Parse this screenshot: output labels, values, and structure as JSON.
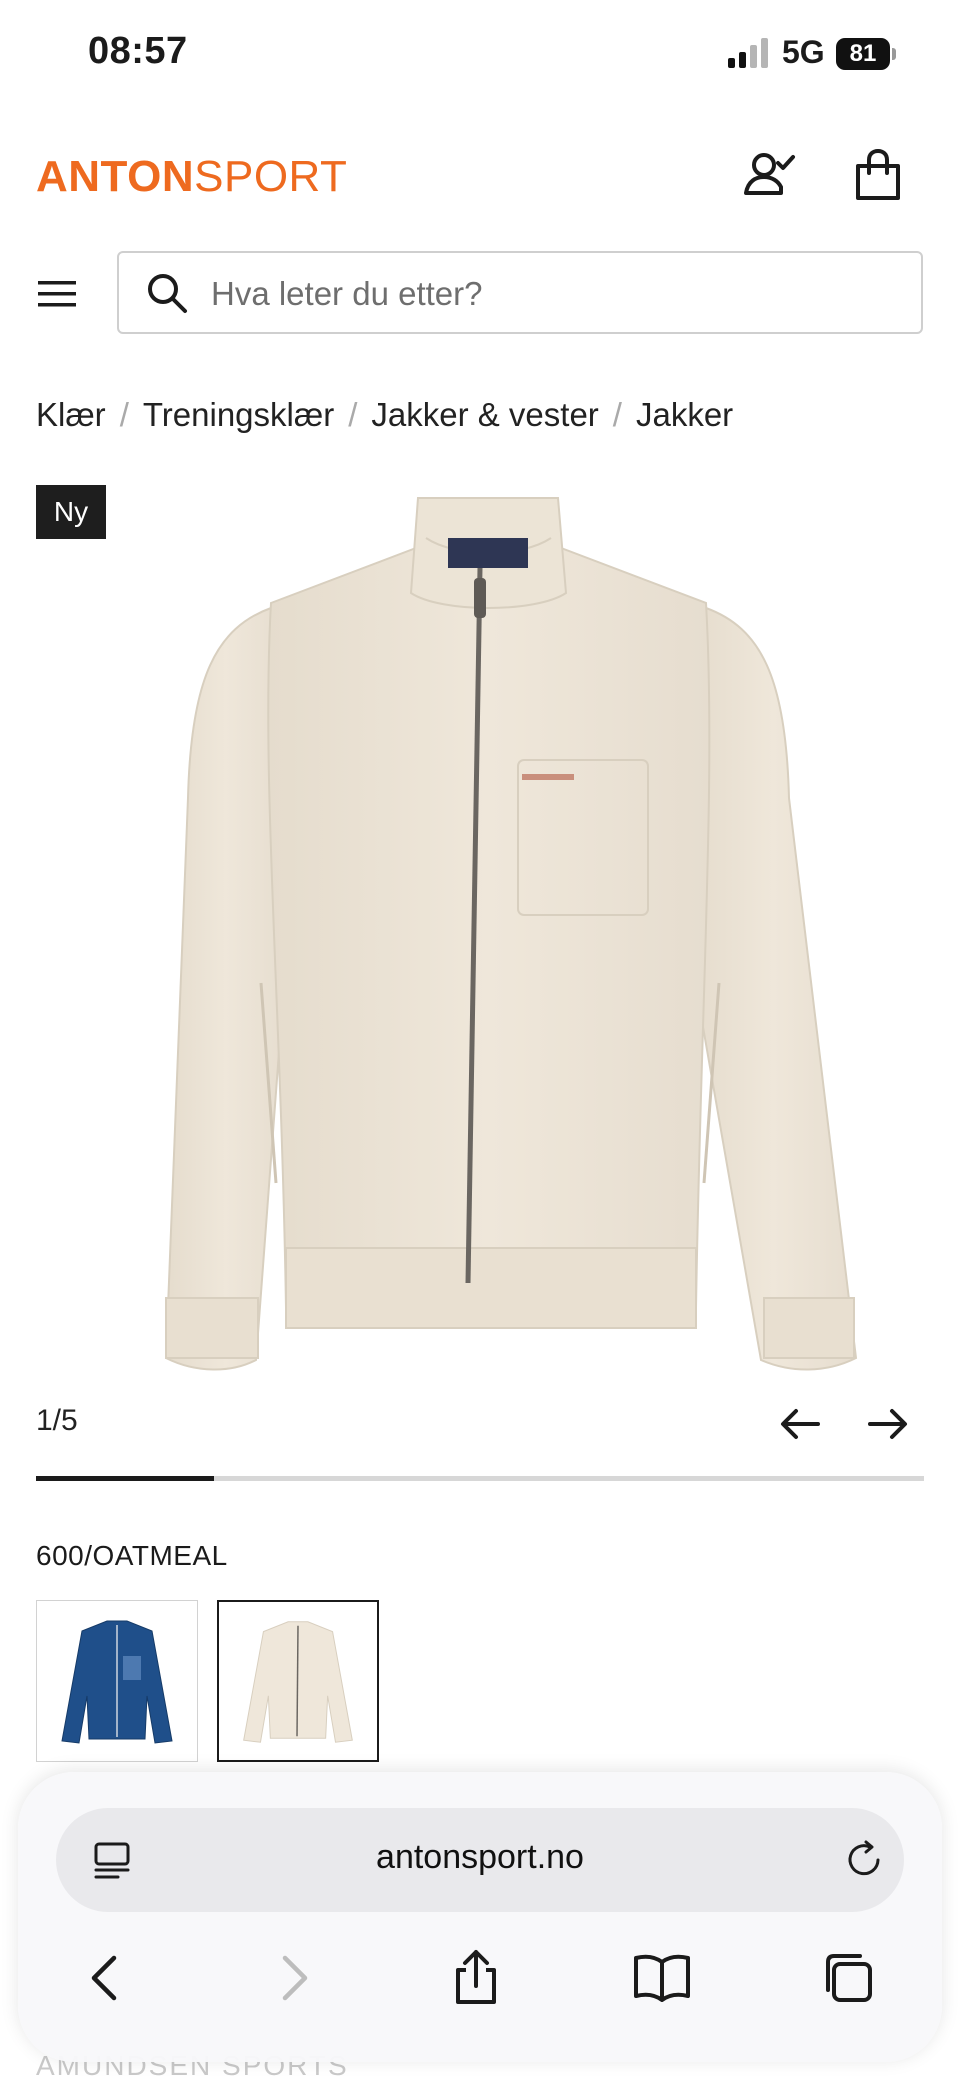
{
  "status_bar": {
    "time": "08:57",
    "network": "5G",
    "battery": "81"
  },
  "header": {
    "brand_bold": "ANTON",
    "brand_light": "SPORT"
  },
  "search": {
    "placeholder": "Hva leter du etter?"
  },
  "breadcrumb": [
    "Klær",
    "Treningsklær",
    "Jakker & vester",
    "Jakker"
  ],
  "product": {
    "badge": "Ny",
    "image_counter": "1/5",
    "image_progress": 0.2,
    "color_label": "600/OATMEAL",
    "jacket_color": "#efe7da",
    "variant_colors": [
      "#1f4f8a",
      "#efe7da"
    ]
  },
  "below_fold": {
    "brand_heading": "AMUNDSEN SPORTS"
  },
  "browser": {
    "url": "antonsport.no"
  },
  "colors": {
    "brand": "#ee6a1f",
    "text": "#1b1b1b"
  }
}
